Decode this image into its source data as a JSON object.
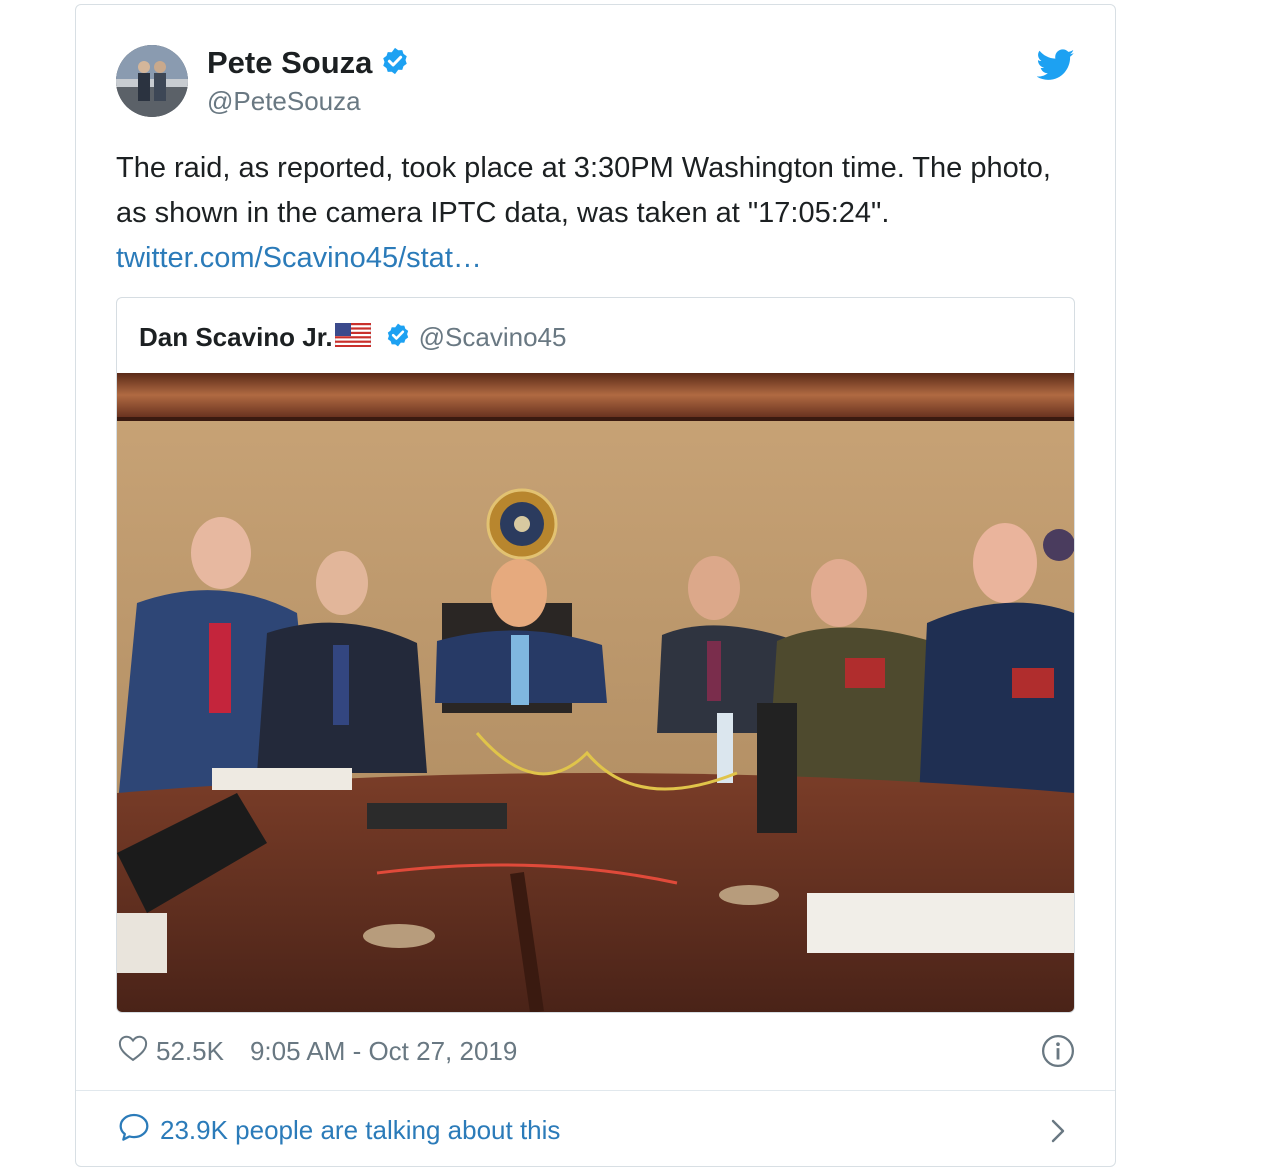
{
  "tweet": {
    "author": {
      "name": "Pete Souza",
      "handle": "@PeteSouza"
    },
    "text": "The raid, as reported, took place at 3:30PM Washington time. The photo, as shown in the camera IPTC data, was taken at \"17:05:24\".",
    "link": "twitter.com/Scavino45/stat…",
    "likes": "52.5K",
    "timestamp": "9:05 AM - Oct 27, 2019",
    "conversation": "23.9K people are talking about this"
  },
  "quoted": {
    "name": "Dan Scavino Jr.",
    "handle": "@Scavino45"
  },
  "icons": {
    "verified": "verified-badge-icon",
    "twitter": "twitter-bird-icon",
    "like": "heart-icon",
    "info": "info-icon",
    "reply": "speech-bubble-icon",
    "more": "chevron-right-icon",
    "flag": "us-flag-icon"
  },
  "colors": {
    "brand": "#1da1f2",
    "link": "#2b7bb9",
    "secondary_text": "#697882",
    "primary_text": "#1c2022",
    "border": "#d8dfe4"
  }
}
